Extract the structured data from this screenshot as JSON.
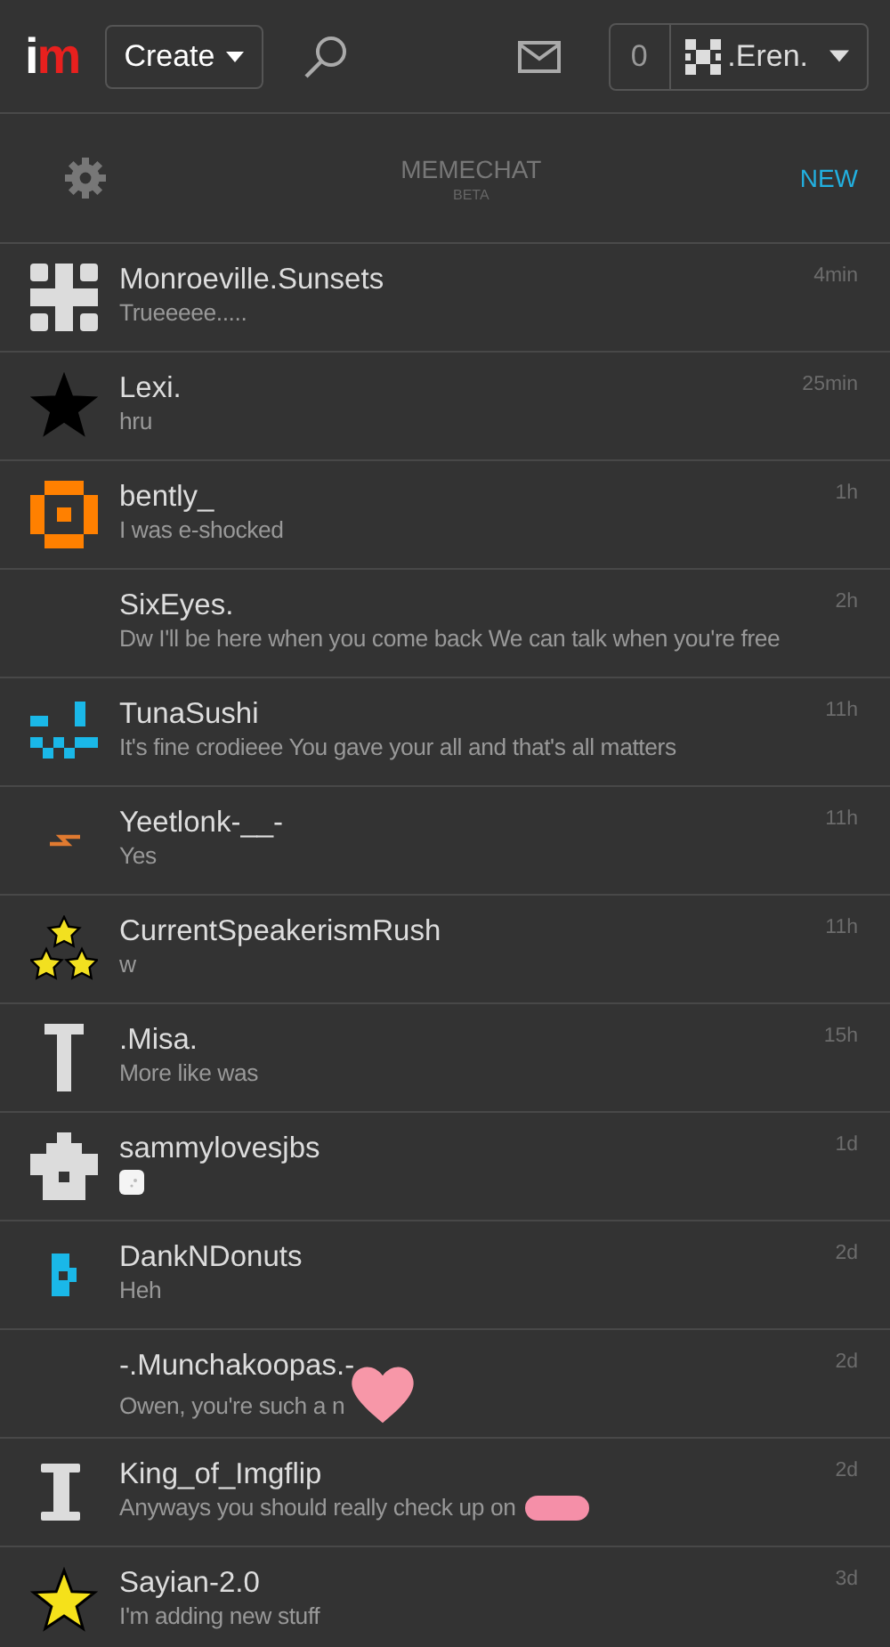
{
  "header": {
    "logo": "im",
    "create_button": "Create",
    "notification_count": "0",
    "user": {
      "name": ".Eren."
    }
  },
  "chat_bar": {
    "title": "MEMECHAT",
    "subtitle": "BETA",
    "new_link": "NEW"
  },
  "conversations": [
    {
      "name": "Monroeville.Sunsets",
      "preview": "Trueeeee.....",
      "time": "4min",
      "kind": "text",
      "avatar": {
        "kind": "grid",
        "color": "#dcdcdc"
      }
    },
    {
      "name": "Lexi.",
      "preview": "hru",
      "time": "25min",
      "kind": "text",
      "avatar": {
        "kind": "star",
        "color": "#000000"
      }
    },
    {
      "name": "bently_",
      "preview": "I was e-shocked",
      "time": "1h",
      "kind": "text",
      "avatar": {
        "kind": "ring",
        "color": "#ff8000"
      }
    },
    {
      "name": "SixEyes.",
      "preview": "Dw I'll be here when you come back We can talk when you're free",
      "time": "2h",
      "kind": "text",
      "avatar": {
        "kind": "none"
      }
    },
    {
      "name": "TunaSushi",
      "preview": "It's fine crodieee You gave your all and that's all matters",
      "time": "11h",
      "kind": "text",
      "avatar": {
        "kind": "blocks",
        "color": "#1ab8e8"
      }
    },
    {
      "name": "Yeetlonk-__-",
      "preview": "Yes",
      "time": "11h",
      "kind": "text",
      "avatar": {
        "kind": "bolt",
        "color": "#e07a30"
      }
    },
    {
      "name": "CurrentSpeakerismRush",
      "preview": "w",
      "time": "11h",
      "kind": "text",
      "avatar": {
        "kind": "stars",
        "color": "#f2e020"
      }
    },
    {
      "name": ".Misa.",
      "preview": "More like was",
      "time": "15h",
      "kind": "text",
      "avatar": {
        "kind": "tee",
        "color": "#dcdcdc"
      }
    },
    {
      "name": "sammylovesjbs",
      "time": "1d",
      "kind": "image",
      "avatar": {
        "kind": "house",
        "color": "#dcdcdc"
      }
    },
    {
      "name": "DankNDonuts",
      "preview": "Heh",
      "time": "2d",
      "kind": "text",
      "avatar": {
        "kind": "tab",
        "color": "#1ab8e8"
      }
    },
    {
      "name": "-.Munchakoopas.-",
      "preview": "Owen, you're such a n",
      "time": "2d",
      "kind": "text",
      "avatar": {
        "kind": "none"
      },
      "redaction": {
        "kind": "heart"
      }
    },
    {
      "name": "King_of_Imgflip",
      "preview": "Anyways you should really check up on",
      "time": "2d",
      "kind": "text",
      "avatar": {
        "kind": "ibeam",
        "color": "#dcdcdc"
      },
      "redaction": {
        "kind": "scribble"
      }
    },
    {
      "name": "Sayian-2.0",
      "preview": "I'm adding new stuff",
      "time": "3d",
      "kind": "text",
      "avatar": {
        "kind": "star",
        "color": "#f5e11a"
      }
    }
  ]
}
